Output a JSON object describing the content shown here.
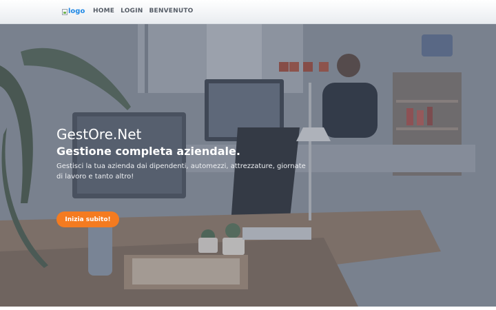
{
  "navbar": {
    "logo_alt": "logo",
    "links": [
      "HOME",
      "LOGIN",
      "BENVENUTO"
    ]
  },
  "hero": {
    "title": "GestOre.Net",
    "subtitle": "Gestione completa aziendale.",
    "description": "Gestisci la tua azienda dai dipendenti, automezzi, attrezzature, giornate di lavoro e tanto altro!",
    "cta_label": "Inizia subito!"
  },
  "colors": {
    "accent": "#f47b20",
    "logo_link": "#1e88e5",
    "nav_text": "#555c66"
  }
}
